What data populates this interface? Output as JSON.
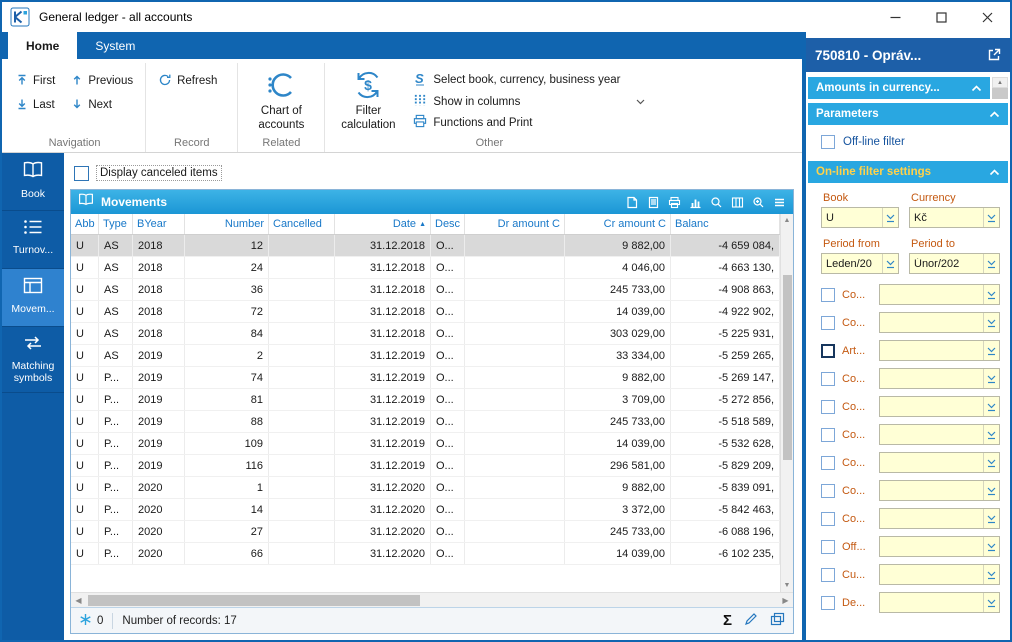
{
  "window": {
    "title": "General ledger - all accounts"
  },
  "ribbon": {
    "tabs": {
      "home": "Home",
      "system": "System"
    },
    "navigation": {
      "first": "First",
      "previous": "Previous",
      "last": "Last",
      "next": "Next",
      "group": "Navigation"
    },
    "record": {
      "refresh": "Refresh",
      "group": "Record"
    },
    "related": {
      "chart_of_accounts": "Chart of accounts",
      "group": "Related"
    },
    "other": {
      "filter_calculation": "Filter calculation",
      "select_book": "Select book, currency, business year",
      "show_in_columns": "Show in columns",
      "functions_and_print": "Functions and Print",
      "group": "Other"
    }
  },
  "sidebar": {
    "active_index": 2,
    "items": [
      {
        "label": "Book"
      },
      {
        "label": "Turnov..."
      },
      {
        "label": "Movem..."
      },
      {
        "label": "Matching symbols"
      }
    ]
  },
  "main": {
    "display_canceled_label": "Display canceled items",
    "panel_title": "Movements",
    "table": {
      "columns": [
        "Abb",
        "Type",
        "BYear",
        "Number",
        "Cancelled",
        "Date",
        "Desc",
        "Dr amount C",
        "Cr amount C",
        "Balanc"
      ],
      "sort_column_index": 5,
      "selected_row_index": 0,
      "rows": [
        [
          "U",
          "AS",
          "2018",
          "12",
          "",
          "31.12.2018",
          "O...",
          "",
          "9 882,00",
          "-4 659 084,"
        ],
        [
          "U",
          "AS",
          "2018",
          "24",
          "",
          "31.12.2018",
          "O...",
          "",
          "4 046,00",
          "-4 663 130,"
        ],
        [
          "U",
          "AS",
          "2018",
          "36",
          "",
          "31.12.2018",
          "O...",
          "",
          "245 733,00",
          "-4 908 863,"
        ],
        [
          "U",
          "AS",
          "2018",
          "72",
          "",
          "31.12.2018",
          "O...",
          "",
          "14 039,00",
          "-4 922 902,"
        ],
        [
          "U",
          "AS",
          "2018",
          "84",
          "",
          "31.12.2018",
          "O...",
          "",
          "303 029,00",
          "-5 225 931,"
        ],
        [
          "U",
          "AS",
          "2019",
          "2",
          "",
          "31.12.2019",
          "O...",
          "",
          "33 334,00",
          "-5 259 265,"
        ],
        [
          "U",
          "P...",
          "2019",
          "74",
          "",
          "31.12.2019",
          "O...",
          "",
          "9 882,00",
          "-5 269 147,"
        ],
        [
          "U",
          "P...",
          "2019",
          "81",
          "",
          "31.12.2019",
          "O...",
          "",
          "3 709,00",
          "-5 272 856,"
        ],
        [
          "U",
          "P...",
          "2019",
          "88",
          "",
          "31.12.2019",
          "O...",
          "",
          "245 733,00",
          "-5 518 589,"
        ],
        [
          "U",
          "P...",
          "2019",
          "109",
          "",
          "31.12.2019",
          "O...",
          "",
          "14 039,00",
          "-5 532 628,"
        ],
        [
          "U",
          "P...",
          "2019",
          "116",
          "",
          "31.12.2019",
          "O...",
          "",
          "296 581,00",
          "-5 829 209,"
        ],
        [
          "U",
          "P...",
          "2020",
          "1",
          "",
          "31.12.2020",
          "O...",
          "",
          "9 882,00",
          "-5 839 091,"
        ],
        [
          "U",
          "P...",
          "2020",
          "14",
          "",
          "31.12.2020",
          "O...",
          "",
          "3 372,00",
          "-5 842 463,"
        ],
        [
          "U",
          "P...",
          "2020",
          "27",
          "",
          "31.12.2020",
          "O...",
          "",
          "245 733,00",
          "-6 088 196,"
        ],
        [
          "U",
          "P...",
          "2020",
          "66",
          "",
          "31.12.2020",
          "O...",
          "",
          "14 039,00",
          "-6 102 235,"
        ]
      ]
    },
    "status": {
      "counter": "0",
      "records_label": "Number of records: 17"
    }
  },
  "right_panel": {
    "title": "750810 - Opráv...",
    "sections": {
      "amounts": "Amounts in currency...",
      "parameters": "Parameters",
      "online_filter": "On-line filter settings"
    },
    "offline_filter_label": "Off-line filter",
    "fields": {
      "book_label": "Book",
      "book_value": "U",
      "currency_label": "Currency",
      "currency_value": "Kč",
      "period_from_label": "Period from",
      "period_from_value": "Leden/20",
      "period_to_label": "Period to",
      "period_to_value": "Únor/202"
    },
    "filters": [
      {
        "label": "Co...",
        "value": "",
        "checked": false,
        "focused": false
      },
      {
        "label": "Co...",
        "value": "",
        "checked": false,
        "focused": false
      },
      {
        "label": "Art...",
        "value": "",
        "checked": false,
        "focused": true
      },
      {
        "label": "Co...",
        "value": "",
        "checked": false,
        "focused": false
      },
      {
        "label": "Co...",
        "value": "",
        "checked": false,
        "focused": false
      },
      {
        "label": "Co...",
        "value": "",
        "checked": false,
        "focused": false
      },
      {
        "label": "Co...",
        "value": "",
        "checked": false,
        "focused": false
      },
      {
        "label": "Co...",
        "value": "",
        "checked": false,
        "focused": false
      },
      {
        "label": "Co...",
        "value": "",
        "checked": false,
        "focused": false
      },
      {
        "label": "Off...",
        "value": "",
        "checked": false,
        "focused": false
      },
      {
        "label": "Cu...",
        "value": "",
        "checked": false,
        "focused": false
      },
      {
        "label": "De...",
        "value": "",
        "checked": false,
        "focused": false
      }
    ]
  },
  "colors": {
    "primary_blue": "#1065b0",
    "sidebar_blue": "#0e5ca6",
    "sidebar_active": "#2f82cf",
    "section_blue": "#29a7e1",
    "detail_header_blue": "#1d5fa8",
    "grid_header_text": "#1878c8",
    "label_orange": "#c45911",
    "input_yellow": "#ffffd6",
    "selected_row_gray": "#d9d9d9",
    "online_filter_title": "#ffd24a"
  }
}
